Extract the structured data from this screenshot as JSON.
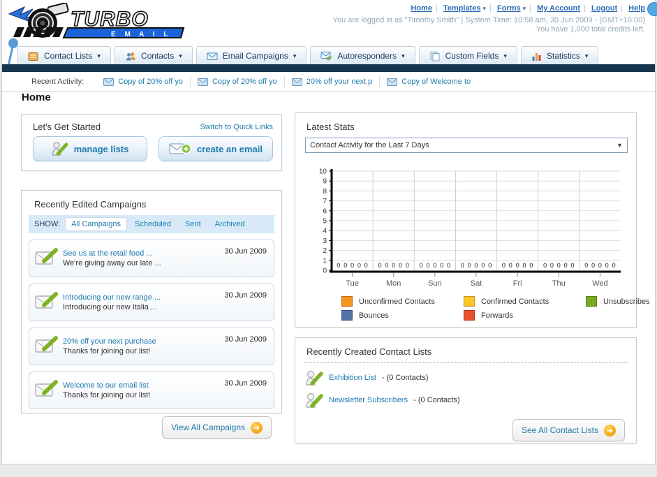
{
  "icons": {
    "dropdown_arrow": "▾",
    "select_arrow": "▼",
    "arrow_right": "➜",
    "plus": "+"
  },
  "header": {
    "logo": {
      "line1": "TURBO",
      "line2": "E M A I L"
    },
    "nav": [
      {
        "label": "Home",
        "has_arrow": false
      },
      {
        "label": "Templates",
        "has_arrow": true
      },
      {
        "label": "Forms",
        "has_arrow": true
      },
      {
        "label": "My Account",
        "has_arrow": false
      },
      {
        "label": "Logout",
        "has_arrow": false
      },
      {
        "label": "Help",
        "has_arrow": false
      }
    ],
    "login_info": "You are logged in as \"Timothy Smith\" | System Time: 10:58 am, 30 Jun 2009 - (GMT+10:00)",
    "credits_info": "You have 1,000 total credits left."
  },
  "tabs": [
    {
      "label": "Contact Lists"
    },
    {
      "label": "Contacts"
    },
    {
      "label": "Email Campaigns"
    },
    {
      "label": "Autoresponders"
    },
    {
      "label": "Custom Fields"
    },
    {
      "label": "Statistics"
    }
  ],
  "recent_activity": {
    "label": "Recent Activity:",
    "items": [
      "Copy of 20% off yo",
      "Copy of 20% off yo",
      "20% off your next p",
      "Copy of Welcome to"
    ]
  },
  "page": {
    "heading": "Home"
  },
  "getting_started": {
    "title": "Let's Get Started",
    "switch_link": "Switch to Quick Links",
    "manage_lists_label": "manage lists",
    "create_email_label": "create an email"
  },
  "campaigns": {
    "title": "Recently Edited Campaigns",
    "show_label": "SHOW:",
    "filters": [
      "All Campaigns",
      "Scheduled",
      "Sent",
      "Archived"
    ],
    "active_filter": "All Campaigns",
    "items": [
      {
        "title": "See us at the retail food ...",
        "subtitle": "We're giving away our late ...",
        "date": "30 Jun 2009"
      },
      {
        "title": "Introducing our new range ...",
        "subtitle": "Introducing our new Italia ...",
        "date": "30 Jun 2009"
      },
      {
        "title": "20% off your next purchase",
        "subtitle": "Thanks for joining our list!",
        "date": "30 Jun 2009"
      },
      {
        "title": "Welcome to our email list",
        "subtitle": "Thanks for joining our list!",
        "date": "30 Jun 2009"
      }
    ],
    "view_all_label": "View All Campaigns"
  },
  "stats": {
    "title": "Latest Stats",
    "selected_option": "Contact Activity for the Last 7 Days",
    "legend": [
      {
        "label": "Unconfirmed Contacts",
        "color": "#F7941D"
      },
      {
        "label": "Confirmed Contacts",
        "color": "#FDC62B"
      },
      {
        "label": "Unsubscribes",
        "color": "#7AA821"
      },
      {
        "label": "Bounces",
        "color": "#5572A7"
      },
      {
        "label": "Forwards",
        "color": "#E8502D"
      }
    ]
  },
  "chart_data": {
    "type": "bar",
    "title": "",
    "xlabel": "",
    "ylabel": "",
    "categories": [
      "Tue",
      "Mon",
      "Sun",
      "Sat",
      "Fri",
      "Thu",
      "Wed"
    ],
    "series": [
      {
        "name": "Unconfirmed Contacts",
        "color": "#F7941D",
        "values": [
          0,
          0,
          0,
          0,
          0,
          0,
          0
        ]
      },
      {
        "name": "Confirmed Contacts",
        "color": "#FDC62B",
        "values": [
          0,
          0,
          0,
          0,
          0,
          0,
          0
        ]
      },
      {
        "name": "Unsubscribes",
        "color": "#7AA821",
        "values": [
          0,
          0,
          0,
          0,
          0,
          0,
          0
        ]
      },
      {
        "name": "Bounces",
        "color": "#5572A7",
        "values": [
          0,
          0,
          0,
          0,
          0,
          0,
          0
        ]
      },
      {
        "name": "Forwards",
        "color": "#E8502D",
        "values": [
          0,
          0,
          0,
          0,
          0,
          0,
          0
        ]
      }
    ],
    "ylim": [
      0,
      10
    ],
    "yticks": [
      0,
      1,
      2,
      3,
      4,
      5,
      6,
      7,
      8,
      9,
      10
    ],
    "value_labels_shown": true,
    "grid": true,
    "legend_position": "bottom"
  },
  "contact_lists": {
    "title": "Recently Created Contact Lists",
    "items": [
      {
        "name": "Exhibition List",
        "suffix": "- (0 Contacts)"
      },
      {
        "name": "Newsletter Subscribers",
        "suffix": "- (0 Contacts)"
      }
    ],
    "see_all_label": "See All Contact Lists"
  }
}
